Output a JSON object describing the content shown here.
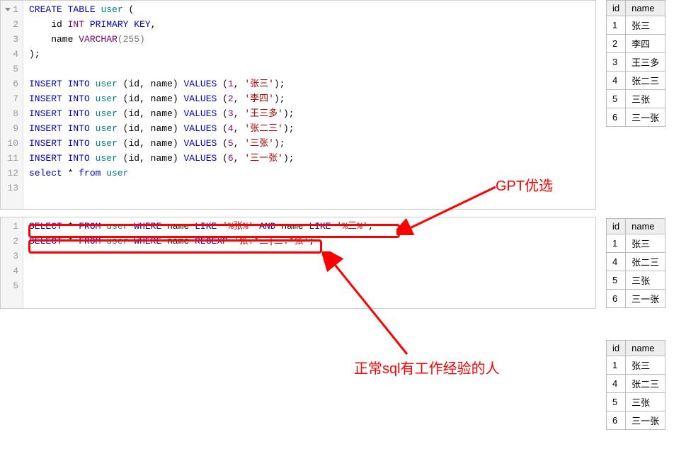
{
  "editor_top": {
    "lines": [
      [
        {
          "cls": "kw-blue",
          "t": "CREATE"
        },
        {
          "t": " "
        },
        {
          "cls": "kw-blue",
          "t": "TABLE"
        },
        {
          "t": " "
        },
        {
          "cls": "kw-teal",
          "t": "user"
        },
        {
          "t": " ("
        }
      ],
      [
        {
          "t": "    id "
        },
        {
          "cls": "kw-purple",
          "t": "INT"
        },
        {
          "t": " "
        },
        {
          "cls": "kw-blue",
          "t": "PRIMARY"
        },
        {
          "t": " "
        },
        {
          "cls": "kw-blue",
          "t": "KEY"
        },
        {
          "t": ","
        }
      ],
      [
        {
          "t": "    name "
        },
        {
          "cls": "kw-purple",
          "t": "VARCHAR"
        },
        {
          "cls": "fn-grey",
          "t": "(255)"
        }
      ],
      [
        {
          "t": ");"
        }
      ],
      [
        {
          "t": ""
        }
      ],
      [
        {
          "cls": "kw-blue",
          "t": "INSERT"
        },
        {
          "t": " "
        },
        {
          "cls": "kw-blue",
          "t": "INTO"
        },
        {
          "t": " "
        },
        {
          "cls": "kw-teal",
          "t": "user"
        },
        {
          "t": " (id, name) "
        },
        {
          "cls": "kw-blue",
          "t": "VALUES"
        },
        {
          "t": " ("
        },
        {
          "cls": "num-purple",
          "t": "1"
        },
        {
          "t": ", "
        },
        {
          "cls": "str-red",
          "t": "'张三'"
        },
        {
          "t": ");"
        }
      ],
      [
        {
          "cls": "kw-blue",
          "t": "INSERT"
        },
        {
          "t": " "
        },
        {
          "cls": "kw-blue",
          "t": "INTO"
        },
        {
          "t": " "
        },
        {
          "cls": "kw-teal",
          "t": "user"
        },
        {
          "t": " (id, name) "
        },
        {
          "cls": "kw-blue",
          "t": "VALUES"
        },
        {
          "t": " ("
        },
        {
          "cls": "num-purple",
          "t": "2"
        },
        {
          "t": ", "
        },
        {
          "cls": "str-red",
          "t": "'李四'"
        },
        {
          "t": ");"
        }
      ],
      [
        {
          "cls": "kw-blue",
          "t": "INSERT"
        },
        {
          "t": " "
        },
        {
          "cls": "kw-blue",
          "t": "INTO"
        },
        {
          "t": " "
        },
        {
          "cls": "kw-teal",
          "t": "user"
        },
        {
          "t": " (id, name) "
        },
        {
          "cls": "kw-blue",
          "t": "VALUES"
        },
        {
          "t": " ("
        },
        {
          "cls": "num-purple",
          "t": "3"
        },
        {
          "t": ", "
        },
        {
          "cls": "str-red",
          "t": "'王三多'"
        },
        {
          "t": ");"
        }
      ],
      [
        {
          "cls": "kw-blue",
          "t": "INSERT"
        },
        {
          "t": " "
        },
        {
          "cls": "kw-blue",
          "t": "INTO"
        },
        {
          "t": " "
        },
        {
          "cls": "kw-teal",
          "t": "user"
        },
        {
          "t": " (id, name) "
        },
        {
          "cls": "kw-blue",
          "t": "VALUES"
        },
        {
          "t": " ("
        },
        {
          "cls": "num-purple",
          "t": "4"
        },
        {
          "t": ", "
        },
        {
          "cls": "str-red",
          "t": "'张二三'"
        },
        {
          "t": ");"
        }
      ],
      [
        {
          "cls": "kw-blue",
          "t": "INSERT"
        },
        {
          "t": " "
        },
        {
          "cls": "kw-blue",
          "t": "INTO"
        },
        {
          "t": " "
        },
        {
          "cls": "kw-teal",
          "t": "user"
        },
        {
          "t": " (id, name) "
        },
        {
          "cls": "kw-blue",
          "t": "VALUES"
        },
        {
          "t": " ("
        },
        {
          "cls": "num-purple",
          "t": "5"
        },
        {
          "t": ", "
        },
        {
          "cls": "str-red",
          "t": "'三张'"
        },
        {
          "t": ");"
        }
      ],
      [
        {
          "cls": "kw-blue",
          "t": "INSERT"
        },
        {
          "t": " "
        },
        {
          "cls": "kw-blue",
          "t": "INTO"
        },
        {
          "t": " "
        },
        {
          "cls": "kw-teal",
          "t": "user"
        },
        {
          "t": " (id, name) "
        },
        {
          "cls": "kw-blue",
          "t": "VALUES"
        },
        {
          "t": " ("
        },
        {
          "cls": "num-purple",
          "t": "6"
        },
        {
          "t": ", "
        },
        {
          "cls": "str-red",
          "t": "'三一张'"
        },
        {
          "t": ");"
        }
      ],
      [
        {
          "cls": "kw-blue",
          "t": "select"
        },
        {
          "t": " * "
        },
        {
          "cls": "kw-blue",
          "t": "from"
        },
        {
          "t": " "
        },
        {
          "cls": "kw-teal",
          "t": "user"
        }
      ],
      [
        {
          "t": ""
        }
      ]
    ],
    "line_numbers": [
      "1",
      "2",
      "3",
      "4",
      "5",
      "6",
      "7",
      "8",
      "9",
      "10",
      "11",
      "12",
      "13"
    ]
  },
  "editor_bottom": {
    "lines": [
      [
        {
          "cls": "kw-blue",
          "t": "SELECT"
        },
        {
          "t": " * "
        },
        {
          "cls": "kw-blue",
          "t": "FROM"
        },
        {
          "t": " "
        },
        {
          "cls": "kw-teal",
          "t": "user"
        },
        {
          "t": " "
        },
        {
          "cls": "kw-blue",
          "t": "WHERE"
        },
        {
          "t": " name "
        },
        {
          "cls": "kw-blue",
          "t": "LIKE"
        },
        {
          "t": " "
        },
        {
          "cls": "str-red",
          "t": "'%张%'"
        },
        {
          "t": " "
        },
        {
          "cls": "kw-blue",
          "t": "AND"
        },
        {
          "t": " name "
        },
        {
          "cls": "kw-blue",
          "t": "LIKE"
        },
        {
          "t": " "
        },
        {
          "cls": "str-red",
          "t": "'%三%'"
        },
        {
          "t": ";"
        }
      ],
      [
        {
          "cls": "kw-blue",
          "t": "SELECT"
        },
        {
          "t": " * "
        },
        {
          "cls": "kw-blue",
          "t": "FROM"
        },
        {
          "t": " "
        },
        {
          "cls": "kw-teal",
          "t": "user"
        },
        {
          "t": " "
        },
        {
          "cls": "kw-blue",
          "t": "WHERE"
        },
        {
          "t": " name "
        },
        {
          "cls": "kw-blue",
          "t": "REGEXP"
        },
        {
          "t": " "
        },
        {
          "cls": "str-red",
          "t": "'张.*三|三.*张'"
        },
        {
          "t": ";"
        }
      ],
      [
        {
          "t": ""
        }
      ],
      [
        {
          "t": ""
        }
      ],
      [
        {
          "t": ""
        }
      ]
    ],
    "line_numbers": [
      "1",
      "2",
      "3",
      "4",
      "5"
    ]
  },
  "tables": {
    "t1": {
      "headers": [
        "id",
        "name"
      ],
      "rows": [
        [
          "1",
          "张三"
        ],
        [
          "2",
          "李四"
        ],
        [
          "3",
          "王三多"
        ],
        [
          "4",
          "张二三"
        ],
        [
          "5",
          "三张"
        ],
        [
          "6",
          "三一张"
        ]
      ]
    },
    "t2": {
      "headers": [
        "id",
        "name"
      ],
      "rows": [
        [
          "1",
          "张三"
        ],
        [
          "4",
          "张二三"
        ],
        [
          "5",
          "三张"
        ],
        [
          "6",
          "三一张"
        ]
      ]
    },
    "t3": {
      "headers": [
        "id",
        "name"
      ],
      "rows": [
        [
          "1",
          "张三"
        ],
        [
          "4",
          "张二三"
        ],
        [
          "5",
          "三张"
        ],
        [
          "6",
          "三一张"
        ]
      ]
    }
  },
  "annotations": {
    "label1": "GPT优选",
    "label2": "正常sql有工作经验的人"
  }
}
